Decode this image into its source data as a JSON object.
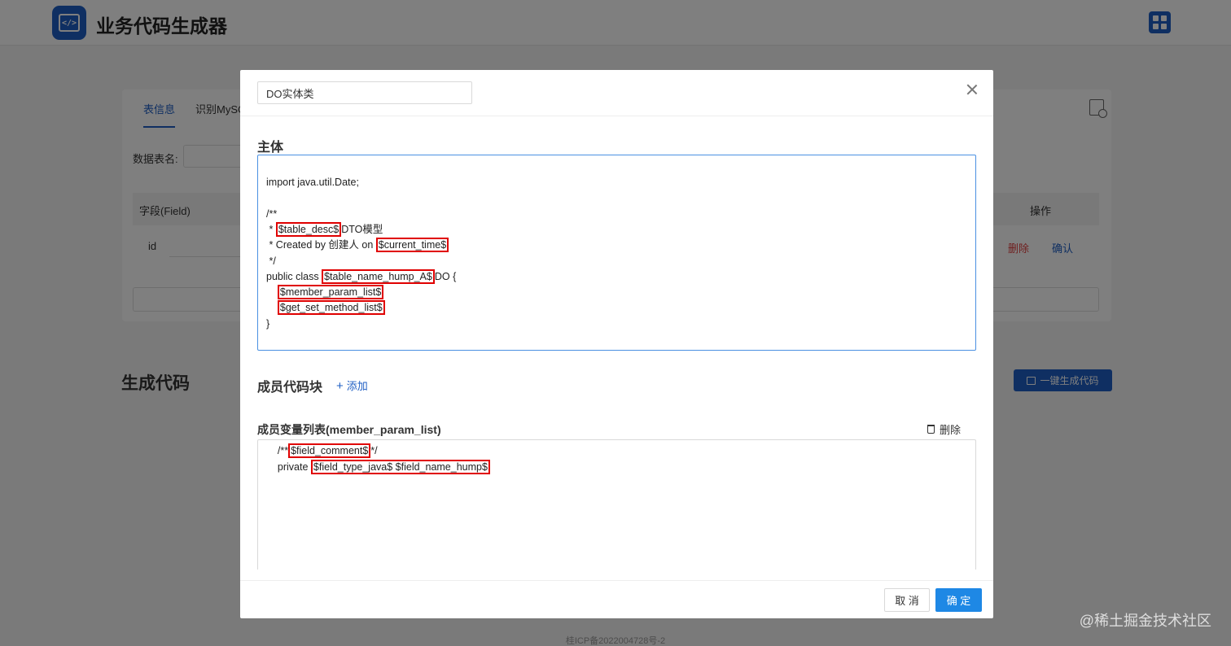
{
  "app": {
    "title": "业务代码生成器",
    "logo_text": "</>"
  },
  "tabs": [
    "表信息",
    "识别MySC"
  ],
  "form": {
    "table_name_label": "数据表名:"
  },
  "table": {
    "headers": {
      "field": "字段(Field)",
      "actions": "操作"
    },
    "row": {
      "field": "id",
      "delete": "删除",
      "confirm": "确认"
    }
  },
  "generate": {
    "title": "生成代码",
    "button": "一键生成代码"
  },
  "icp": "桂ICP备2022004728号-2",
  "watermark": "@稀土掘金技术社区",
  "modal": {
    "name_value": "DO实体类",
    "body_title": "主体",
    "code_lines": [
      [
        "import java.util.Date;"
      ],
      [
        ""
      ],
      [
        "/**"
      ],
      [
        " * ",
        {
          "hl": "$table_desc$"
        },
        "DTO模型"
      ],
      [
        " * Created by 创建人 on ",
        {
          "hl": "$current_time$"
        }
      ],
      [
        " */"
      ],
      [
        "public class ",
        {
          "hl": "$table_name_hump_A$"
        },
        "DO {"
      ],
      [
        "    ",
        {
          "hl": "$member_param_list$"
        }
      ],
      [
        "    ",
        {
          "hl": "$get_set_method_list$"
        }
      ],
      [
        "}"
      ]
    ],
    "members_title": "成员代码块",
    "add_label": "添加",
    "member_block": {
      "title": "成员变量列表(member_param_list)",
      "delete_label": "删除",
      "lines": [
        [
          "    /**",
          {
            "hl": "$field_comment$"
          },
          "*/"
        ],
        [
          "    private ",
          {
            "hl": "$field_type_java$ $field_name_hump$"
          }
        ]
      ]
    },
    "cancel_label": "取 消",
    "ok_label": "确 定"
  }
}
